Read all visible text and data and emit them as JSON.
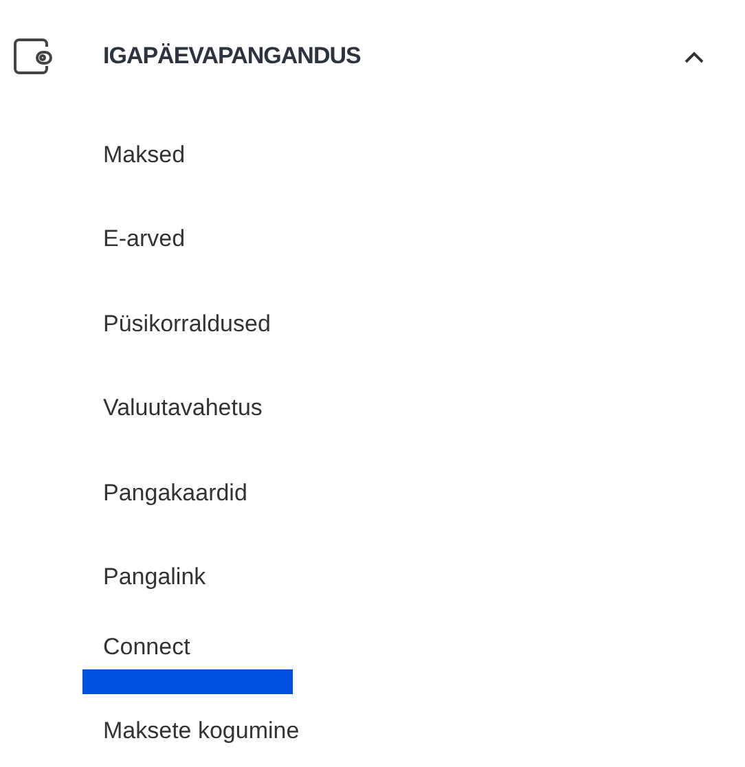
{
  "section": {
    "title": "IGAPÄEVAPANGANDUS",
    "expanded": true,
    "items": [
      {
        "label": "Maksed",
        "selected": false
      },
      {
        "label": "E-arved",
        "selected": false
      },
      {
        "label": "Püsikorraldused",
        "selected": false
      },
      {
        "label": "Valuutavahetus",
        "selected": false
      },
      {
        "label": "Pangakaardid",
        "selected": false
      },
      {
        "label": "Pangalink",
        "selected": false
      },
      {
        "label": "Connect",
        "selected": true
      },
      {
        "label": "Maksete kogumine",
        "selected": false
      }
    ]
  }
}
